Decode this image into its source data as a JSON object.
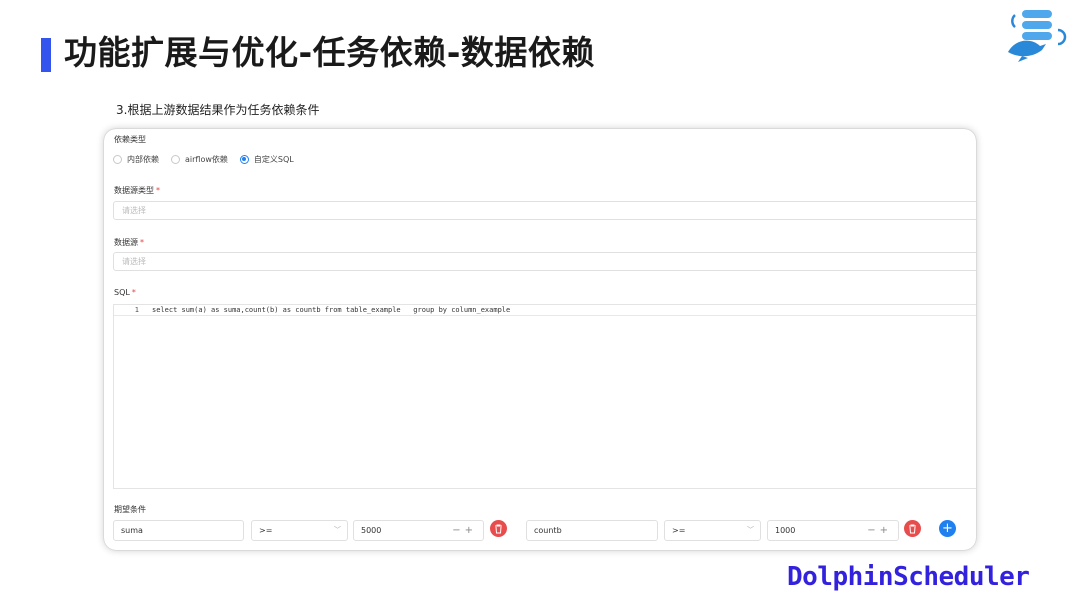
{
  "header": {
    "title": "功能扩展与优化-任务依赖-数据依赖",
    "subtitle": "3.根据上游数据结果作为任务依赖条件"
  },
  "form": {
    "dep_type_label": "依赖类型",
    "dep_types": [
      "内部依赖",
      "airflow依赖",
      "自定义SQL"
    ],
    "dep_type_selected": "自定义SQL",
    "datasource_type_label": "数据源类型",
    "datasource_type_placeholder": "请选择",
    "datasource_label": "数据源",
    "datasource_placeholder": "请选择",
    "sql_label": "SQL",
    "required_mark": "*",
    "sql_line_number": "1",
    "sql_code": "select sum(a) as suma,count(b) as countb from table_example   group by column_example",
    "expect_label": "期望条件",
    "conditions": [
      {
        "field": "suma",
        "operator": ">=",
        "value": "5000"
      },
      {
        "field": "countb",
        "operator": ">=",
        "value": "1000"
      }
    ],
    "stepper": "−+",
    "add_symbol": "+"
  },
  "branding": {
    "name": "DolphinScheduler",
    "logo_icon": "database-dolphin-icon",
    "accent": "#3355ee",
    "primary": "#2080f0",
    "danger": "#e84c4c"
  }
}
